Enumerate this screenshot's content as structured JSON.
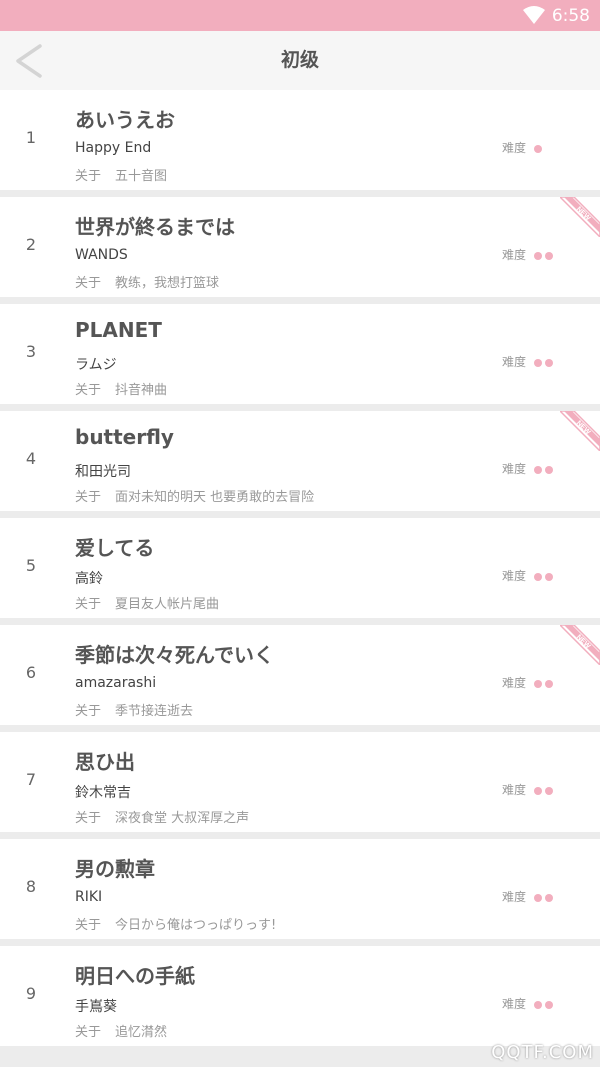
{
  "status": {
    "time": "6:58"
  },
  "header": {
    "title": "初级"
  },
  "labels": {
    "about": "关于",
    "difficulty": "难度",
    "new_badge": "NEW"
  },
  "accent_color": "#f2aebe",
  "songs": [
    {
      "index": "1",
      "title": "あいうえお",
      "artist": "Happy End",
      "about": "五十音图",
      "difficulty": 1,
      "is_new": false
    },
    {
      "index": "2",
      "title": "世界が終るまでは",
      "artist": "WANDS",
      "about": "教练，我想打篮球",
      "difficulty": 2,
      "is_new": true
    },
    {
      "index": "3",
      "title": "PLANET",
      "artist": "ラムジ",
      "about": "抖音神曲",
      "difficulty": 2,
      "is_new": false
    },
    {
      "index": "4",
      "title": "butterfly",
      "artist": "和田光司",
      "about": "面对未知的明天 也要勇敢的去冒险",
      "difficulty": 2,
      "is_new": true
    },
    {
      "index": "5",
      "title": "爱してる",
      "artist": "高鈴",
      "about": "夏目友人帐片尾曲",
      "difficulty": 2,
      "is_new": false
    },
    {
      "index": "6",
      "title": "季節は次々死んでいく",
      "artist": "amazarashi",
      "about": "季节接连逝去",
      "difficulty": 2,
      "is_new": true
    },
    {
      "index": "7",
      "title": "思ひ出",
      "artist": "鈴木常吉",
      "about": "深夜食堂 大叔浑厚之声",
      "difficulty": 2,
      "is_new": false
    },
    {
      "index": "8",
      "title": "男の勲章",
      "artist": "RIKI",
      "about": "今日から俺はつっぱりっす!",
      "difficulty": 2,
      "is_new": false
    },
    {
      "index": "9",
      "title": "明日への手紙",
      "artist": "手嶌葵",
      "about": "追忆潸然",
      "difficulty": 2,
      "is_new": false
    }
  ],
  "watermark": "QQTF.COM"
}
